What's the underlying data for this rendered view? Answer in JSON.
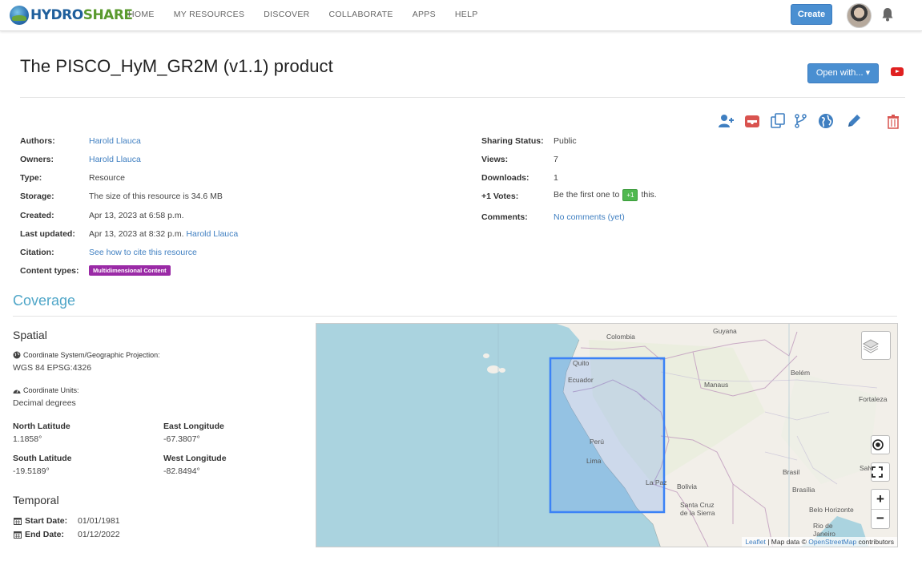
{
  "brand": {
    "hydro": "HYDRO",
    "share": "SHARE"
  },
  "nav": {
    "items": [
      "HOME",
      "MY RESOURCES",
      "DISCOVER",
      "COLLABORATE",
      "APPS",
      "HELP"
    ],
    "create_label": "Create"
  },
  "resource": {
    "title": "The PISCO_HyM_GR2M (v1.1) product",
    "open_with_label": "Open with... ▾"
  },
  "meta_left": {
    "authors_label": "Authors:",
    "authors_value": "Harold Llauca",
    "owners_label": "Owners:",
    "owners_value": "Harold Llauca",
    "type_label": "Type:",
    "type_value": "Resource",
    "storage_label": "Storage:",
    "storage_value": "The size of this resource is 34.6 MB",
    "created_label": "Created:",
    "created_value": "Apr 13, 2023 at 6:58 p.m.",
    "updated_label": "Last updated:",
    "updated_value": "Apr 13, 2023 at 8:32 p.m.",
    "updated_by": "Harold Llauca",
    "citation_label": "Citation:",
    "citation_value": "See how to cite this resource",
    "content_label": "Content types:",
    "content_value": "Multidimensional Content"
  },
  "meta_right": {
    "sharing_label": "Sharing Status:",
    "sharing_value": "Public",
    "views_label": "Views:",
    "views_value": "7",
    "downloads_label": "Downloads:",
    "downloads_value": "1",
    "votes_label": "+1 Votes:",
    "votes_prefix": "Be the first one to",
    "votes_button": "+1",
    "votes_suffix": "this.",
    "comments_label": "Comments:",
    "comments_value": "No comments (yet)"
  },
  "coverage": {
    "title": "Coverage",
    "spatial_title": "Spatial",
    "crs_label": "Coordinate System/Geographic Projection:",
    "crs_value": "WGS 84 EPSG:4326",
    "units_label": "Coordinate Units:",
    "units_value": "Decimal degrees",
    "north_label": "North Latitude",
    "north_value": "1.1858°",
    "east_label": "East Longitude",
    "east_value": "-67.3807°",
    "south_label": "South Latitude",
    "south_value": "-19.5189°",
    "west_label": "West Longitude",
    "west_value": "-82.8494°",
    "temporal_title": "Temporal",
    "start_label": "Start Date:",
    "start_value": "01/01/1981",
    "end_label": "End Date:",
    "end_value": "01/12/2022"
  },
  "map": {
    "cities": [
      "Colombia",
      "Guyana",
      "Quito",
      "Ecuador",
      "Belém",
      "Manaus",
      "Fortaleza",
      "Perú",
      "Lima",
      "Brasil",
      "Brasília",
      "La Paz",
      "Bolivia",
      "Santa Cruz de la Sierra",
      "Belo Horizonte",
      "Rio de Janeiro",
      "Salv"
    ],
    "attribution_leaflet": "Leaflet",
    "attribution_mid": " | Map data © ",
    "attribution_osm": "OpenStreetMap",
    "attribution_end": " contributors",
    "zoom_in": "+",
    "zoom_out": "−",
    "colors": {
      "water": "#aad3df",
      "land": "#f2efe9",
      "bbox": "#3b82f6"
    }
  }
}
